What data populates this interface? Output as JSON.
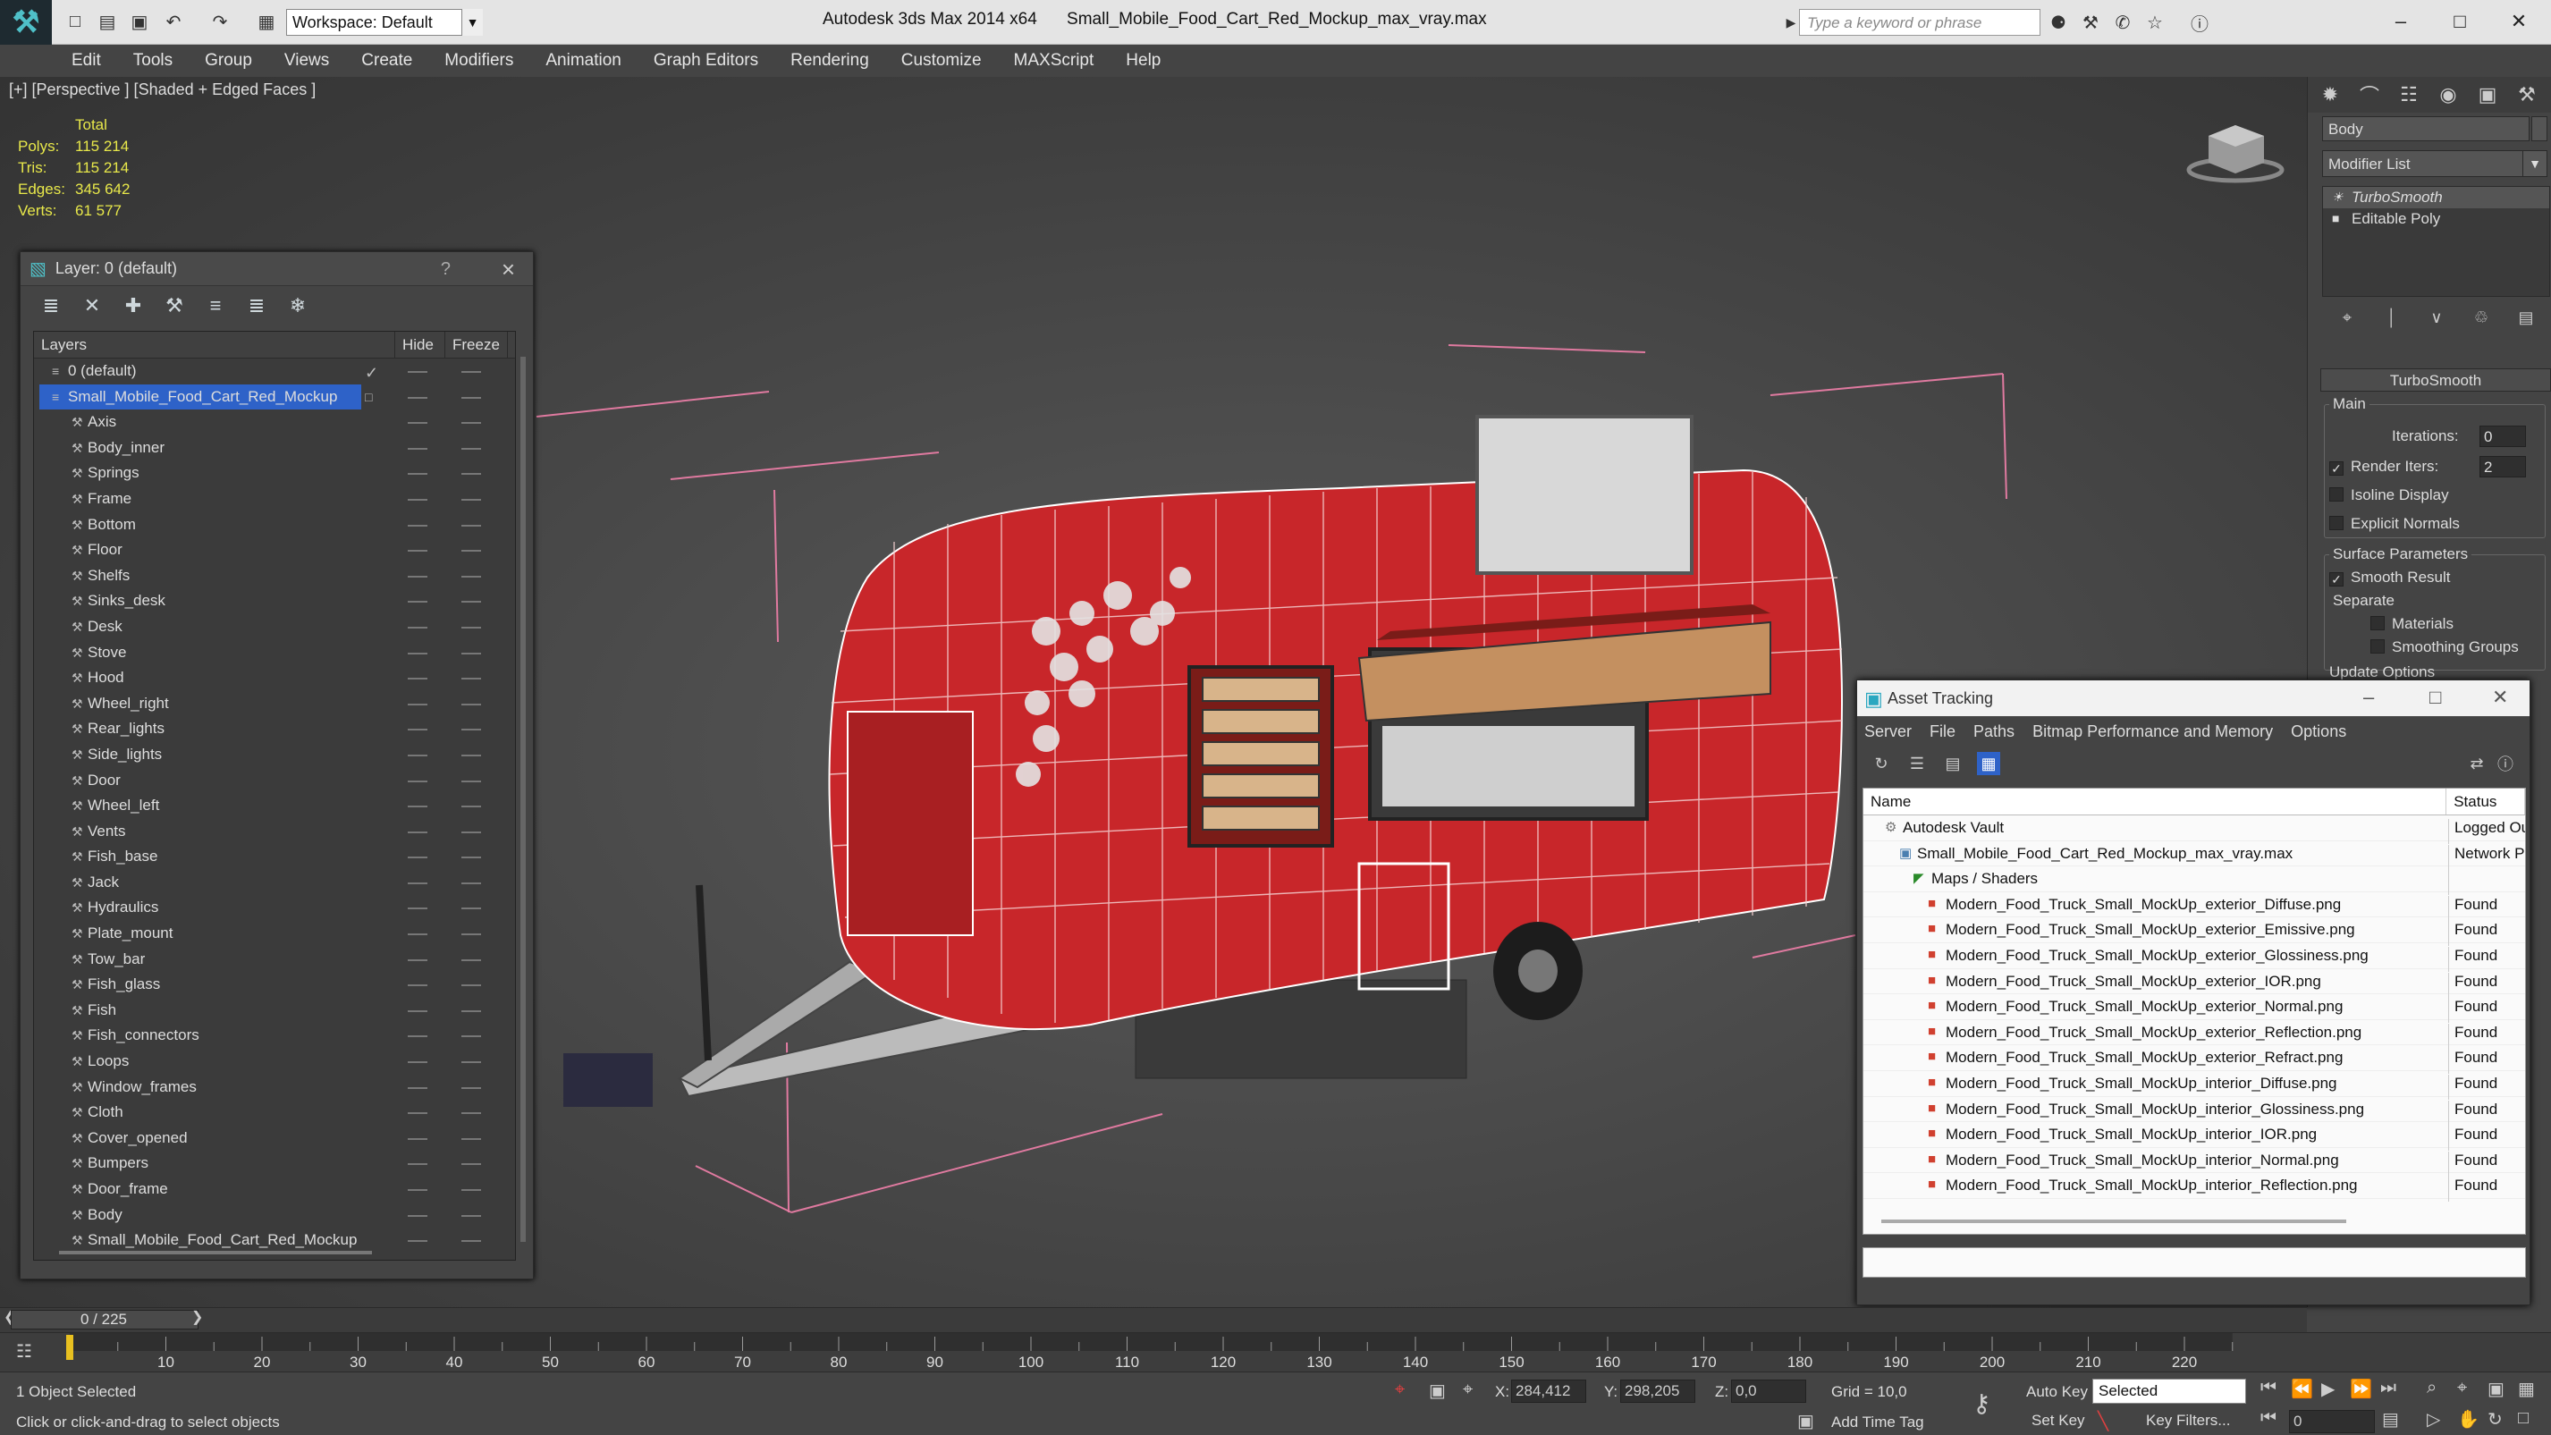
{
  "titlebar": {
    "workspace": "Workspace: Default",
    "app_name": "Autodesk 3ds Max  2014 x64",
    "file_name": "Small_Mobile_Food_Cart_Red_Mockup_max_vray.max",
    "search_placeholder": "Type a keyword or phrase"
  },
  "menu": [
    "Edit",
    "Tools",
    "Group",
    "Views",
    "Create",
    "Modifiers",
    "Animation",
    "Graph Editors",
    "Rendering",
    "Customize",
    "MAXScript",
    "Help"
  ],
  "viewport": {
    "label": "[+] [Perspective ] [Shaded + Edged Faces ]",
    "stats_header": "Total",
    "stats": [
      {
        "label": "Polys:",
        "value": "115 214"
      },
      {
        "label": "Tris:",
        "value": "115 214"
      },
      {
        "label": "Edges:",
        "value": "345 642"
      },
      {
        "label": "Verts:",
        "value": "61 577"
      }
    ]
  },
  "layer_dialog": {
    "title": "Layer: 0 (default)",
    "help": "?",
    "col_layers": "Layers",
    "col_hide": "Hide",
    "col_freeze": "Freeze",
    "rows": [
      "0 (default)",
      "Small_Mobile_Food_Cart_Red_Mockup",
      "Axis",
      "Body_inner",
      "Springs",
      "Frame",
      "Bottom",
      "Floor",
      "Shelfs",
      "Sinks_desk",
      "Desk",
      "Stove",
      "Hood",
      "Wheel_right",
      "Rear_lights",
      "Side_lights",
      "Door",
      "Wheel_left",
      "Vents",
      "Fish_base",
      "Jack",
      "Hydraulics",
      "Plate_mount",
      "Tow_bar",
      "Fish_glass",
      "Fish",
      "Fish_connectors",
      "Loops",
      "Window_frames",
      "Cloth",
      "Cover_opened",
      "Bumpers",
      "Door_frame",
      "Body",
      "Small_Mobile_Food_Cart_Red_Mockup"
    ]
  },
  "command_panel": {
    "object_name": "Body",
    "modifier_list": "Modifier List",
    "stack": [
      "TurboSmooth",
      "Editable Poly"
    ],
    "rollout_title": "TurboSmooth",
    "main_group": "Main",
    "iterations_label": "Iterations:",
    "iterations_value": "0",
    "render_iters_label": "Render Iters:",
    "render_iters_value": "2",
    "isoline_display": "Isoline Display",
    "explicit_normals": "Explicit Normals",
    "surface_params": "Surface Parameters",
    "smooth_result": "Smooth Result",
    "separate": "Separate",
    "materials": "Materials",
    "smoothing_groups": "Smoothing Groups",
    "update_options": "Update Options"
  },
  "asset_tracking": {
    "title": "Asset Tracking",
    "menu": [
      "Server",
      "File",
      "Paths",
      "Bitmap Performance and Memory",
      "Options"
    ],
    "col_name": "Name",
    "col_status": "Status",
    "rows": [
      {
        "name": "Autodesk Vault",
        "status": "Logged Ou",
        "level": 1
      },
      {
        "name": "Small_Mobile_Food_Cart_Red_Mockup_max_vray.max",
        "status": "Network P",
        "level": 2
      },
      {
        "name": "Maps / Shaders",
        "status": "",
        "level": 3
      },
      {
        "name": "Modern_Food_Truck_Small_MockUp_exterior_Diffuse.png",
        "status": "Found",
        "level": 4
      },
      {
        "name": "Modern_Food_Truck_Small_MockUp_exterior_Emissive.png",
        "status": "Found",
        "level": 4
      },
      {
        "name": "Modern_Food_Truck_Small_MockUp_exterior_Glossiness.png",
        "status": "Found",
        "level": 4
      },
      {
        "name": "Modern_Food_Truck_Small_MockUp_exterior_IOR.png",
        "status": "Found",
        "level": 4
      },
      {
        "name": "Modern_Food_Truck_Small_MockUp_exterior_Normal.png",
        "status": "Found",
        "level": 4
      },
      {
        "name": "Modern_Food_Truck_Small_MockUp_exterior_Reflection.png",
        "status": "Found",
        "level": 4
      },
      {
        "name": "Modern_Food_Truck_Small_MockUp_exterior_Refract.png",
        "status": "Found",
        "level": 4
      },
      {
        "name": "Modern_Food_Truck_Small_MockUp_interior_Diffuse.png",
        "status": "Found",
        "level": 4
      },
      {
        "name": "Modern_Food_Truck_Small_MockUp_interior_Glossiness.png",
        "status": "Found",
        "level": 4
      },
      {
        "name": "Modern_Food_Truck_Small_MockUp_interior_IOR.png",
        "status": "Found",
        "level": 4
      },
      {
        "name": "Modern_Food_Truck_Small_MockUp_interior_Normal.png",
        "status": "Found",
        "level": 4
      },
      {
        "name": "Modern_Food_Truck_Small_MockUp_interior_Reflection.png",
        "status": "Found",
        "level": 4
      }
    ]
  },
  "timeline": {
    "frame": "0 / 225",
    "ticks": [
      "10",
      "20",
      "30",
      "40",
      "50",
      "60",
      "70",
      "80",
      "90",
      "100",
      "110",
      "120",
      "130",
      "140",
      "150",
      "160",
      "170",
      "180",
      "190",
      "200",
      "210",
      "220"
    ]
  },
  "statusbar": {
    "selected_count": "1 Object Selected",
    "prompt": "Click or click-and-drag to select objects",
    "x_label": "X:",
    "x_value": "284,412",
    "y_label": "Y:",
    "y_value": "298,205",
    "z_label": "Z:",
    "z_value": "0,0",
    "grid": "Grid = 10,0",
    "add_time_tag": "Add Time Tag",
    "auto_key": "Auto Key",
    "set_key": "Set Key",
    "selected_dropdown": "Selected",
    "key_filters": "Key Filters...",
    "current_frame": "0"
  }
}
